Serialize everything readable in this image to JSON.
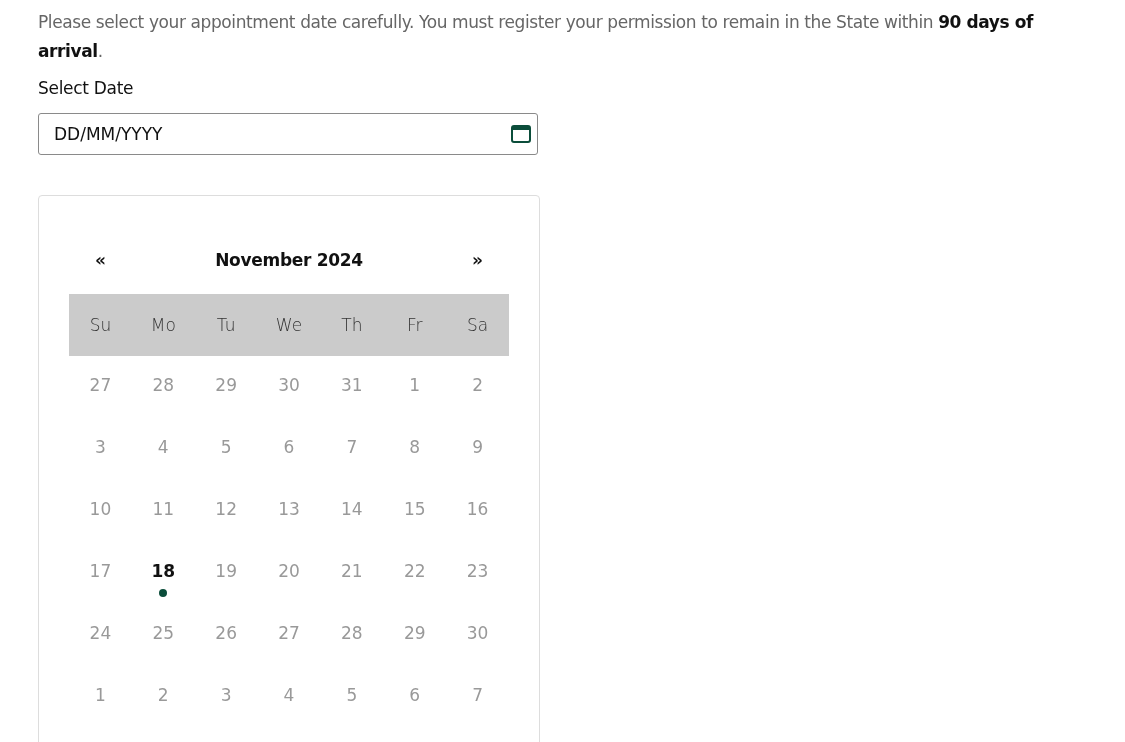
{
  "notice": "Please select your appointment date carefully. You must register your permission to remain in the State within **90 days of arrival**.",
  "date_field": {
    "label": "Select Date",
    "placeholder": "DD/MM/YYYY"
  },
  "calendar": {
    "prev": "«",
    "month": "November 2024",
    "next": "»",
    "weekdays": [
      "Su",
      "Mo",
      "Tu",
      "We",
      "Th",
      "Fr",
      "Sa"
    ],
    "weeks": [
      [
        {
          "day": "27",
          "today": false
        },
        {
          "day": "28",
          "today": false
        },
        {
          "day": "29",
          "today": false
        },
        {
          "day": "30",
          "today": false
        },
        {
          "day": "31",
          "today": false
        },
        {
          "day": "1",
          "today": false
        },
        {
          "day": "2",
          "today": false
        }
      ],
      [
        {
          "day": "3",
          "today": false
        },
        {
          "day": "4",
          "today": false
        },
        {
          "day": "5",
          "today": false
        },
        {
          "day": "6",
          "today": false
        },
        {
          "day": "7",
          "today": false
        },
        {
          "day": "8",
          "today": false
        },
        {
          "day": "9",
          "today": false
        }
      ],
      [
        {
          "day": "10",
          "today": false
        },
        {
          "day": "11",
          "today": false
        },
        {
          "day": "12",
          "today": false
        },
        {
          "day": "13",
          "today": false
        },
        {
          "day": "14",
          "today": false
        },
        {
          "day": "15",
          "today": false
        },
        {
          "day": "16",
          "today": false
        }
      ],
      [
        {
          "day": "17",
          "today": false
        },
        {
          "day": "18",
          "today": true
        },
        {
          "day": "19",
          "today": false
        },
        {
          "day": "20",
          "today": false
        },
        {
          "day": "21",
          "today": false
        },
        {
          "day": "22",
          "today": false
        },
        {
          "day": "23",
          "today": false
        }
      ],
      [
        {
          "day": "24",
          "today": false
        },
        {
          "day": "25",
          "today": false
        },
        {
          "day": "26",
          "today": false
        },
        {
          "day": "27",
          "today": false
        },
        {
          "day": "28",
          "today": false
        },
        {
          "day": "29",
          "today": false
        },
        {
          "day": "30",
          "today": false
        }
      ],
      [
        {
          "day": "1",
          "today": false
        },
        {
          "day": "2",
          "today": false
        },
        {
          "day": "3",
          "today": false
        },
        {
          "day": "4",
          "today": false
        },
        {
          "day": "5",
          "today": false
        },
        {
          "day": "6",
          "today": false
        },
        {
          "day": "7",
          "today": false
        }
      ]
    ]
  }
}
